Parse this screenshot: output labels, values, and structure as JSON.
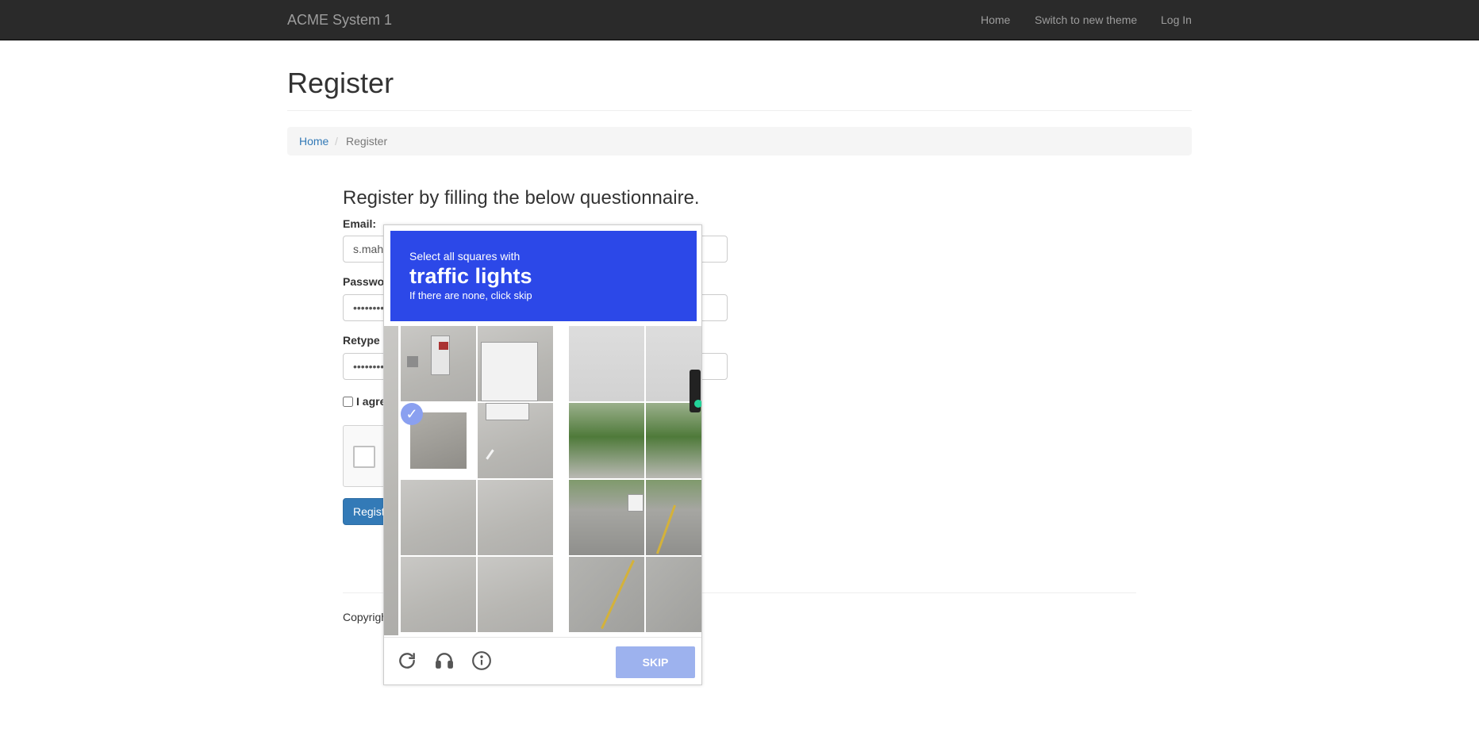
{
  "navbar": {
    "brand": "ACME System 1",
    "links": [
      "Home",
      "Switch to new theme",
      "Log In"
    ]
  },
  "page": {
    "title": "Register",
    "breadcrumb": {
      "home": "Home",
      "separator": "/",
      "current": "Register"
    }
  },
  "form": {
    "title": "Register by filling the below questionnaire.",
    "email_label": "Email:",
    "email_value": "s.mah",
    "password_label": "Passwo",
    "password_value": "••••••••",
    "retype_label": "Retype",
    "retype_value": "••••••••",
    "agree_label": "I agre",
    "register_button": "Regist"
  },
  "footer": {
    "text": "Copyrigh"
  },
  "captcha": {
    "line1": "Select all squares with",
    "line2": "traffic lights",
    "line3": "If there are none, click skip",
    "skip_label": "SKIP",
    "icons": [
      "reload-icon",
      "headphones-icon",
      "info-icon"
    ],
    "accent": "#2c48e8"
  }
}
